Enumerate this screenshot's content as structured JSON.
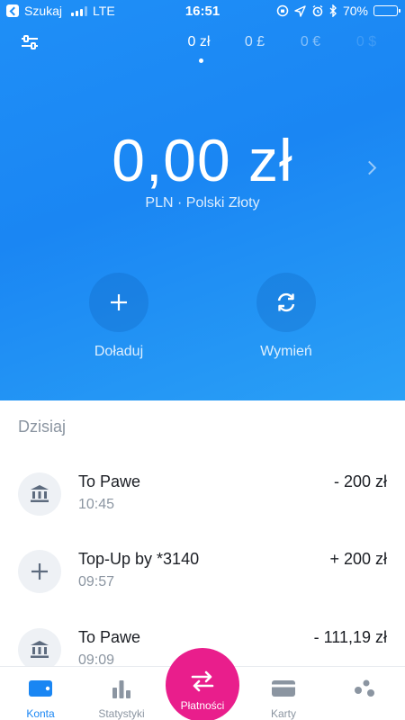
{
  "status_bar": {
    "back_label": "Szukaj",
    "network": "LTE",
    "time": "16:51",
    "battery": "70%",
    "battery_level": 0.7
  },
  "currency_tabs": [
    "0 zł",
    "0 £",
    "0 €",
    "0 $"
  ],
  "account": {
    "balance": "0,00 zł",
    "currency_desc": "PLN · Polski Złoty"
  },
  "actions": {
    "topup_label": "Doładuj",
    "exchange_label": "Wymień"
  },
  "transactions": {
    "section_title": "Dzisiaj",
    "items": [
      {
        "icon": "bank-icon",
        "title": "To Pawe",
        "time": "10:45",
        "amount": "- 200 zł"
      },
      {
        "icon": "plus-icon",
        "title": "Top-Up by *3140",
        "time": "09:57",
        "amount": "+ 200 zł"
      },
      {
        "icon": "bank-icon",
        "title": "To Pawe",
        "time": "09:09",
        "amount": "- 111,19 zł"
      }
    ]
  },
  "tabbar": {
    "konta": "Konta",
    "statystyki": "Statystyki",
    "platnosci": "Płatności",
    "karty": "Karty"
  },
  "colors": {
    "accent": "#1a86f3",
    "payment": "#e91e8c",
    "muted_text": "#8b95a1"
  }
}
